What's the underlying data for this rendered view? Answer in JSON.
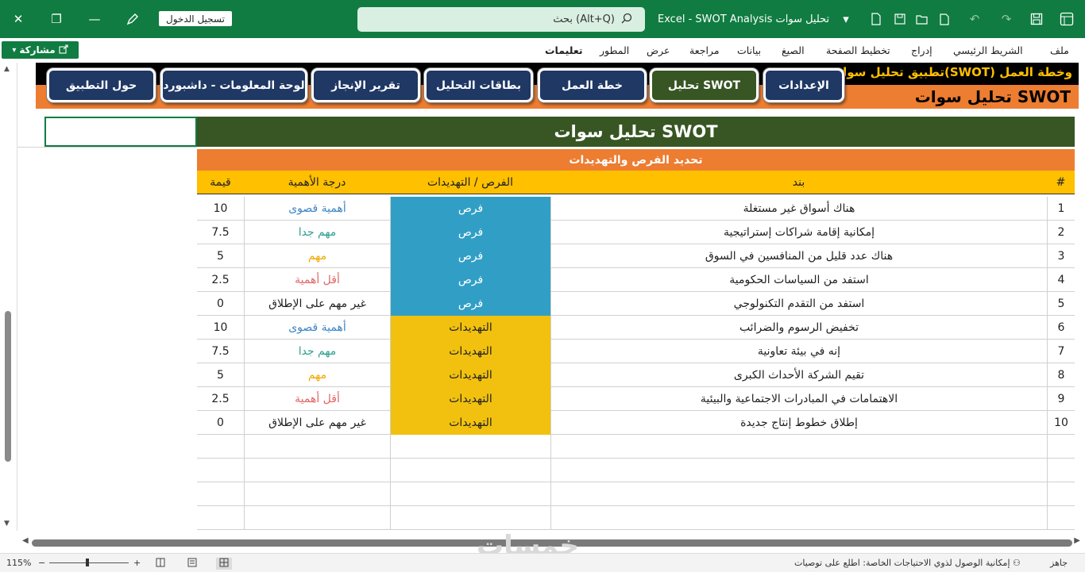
{
  "window": {
    "close": "✕",
    "restore": "❐",
    "minimize": "—",
    "signin": "تسجيل الدخول",
    "search": "بحث (Alt+Q)",
    "doc_title": "Excel  -  SWOT Analysis  تحليل سوات",
    "colors": {
      "excel_green": "#107c41"
    }
  },
  "share": "مشاركة",
  "ribbon": {
    "tabs": [
      "ملف",
      "الشريط الرئيسي",
      "إدراج",
      "تخطيط الصفحة",
      "الصيغ",
      "بيانات",
      "مراجعة",
      "عرض",
      "المطور",
      "تعليمات"
    ]
  },
  "app": {
    "name": "تطبيق تحليل سوات(SWOT) وخطة العمل",
    "page_title": "تحليل سوات SWOT",
    "nav": [
      "الإعدادات",
      "تحليل SWOT",
      "خطة العمل",
      "بطاقات التحليل",
      "تقرير الإنجاز",
      "لوحة المعلومات - داشبورد",
      "حول التطبيق"
    ],
    "active_nav": "تحليل SWOT",
    "colors": {
      "navy": "#1f3864",
      "dark_green": "#375623",
      "orange": "#ed7d31",
      "gold": "#ffc000",
      "opportunity_blue": "#319fc5"
    }
  },
  "table": {
    "title": "تحليل سوات SWOT",
    "subtitle": "تحديد الفرص والتهديدات",
    "headers": {
      "num": "#",
      "item": "بند",
      "type": "الفرص / التهديدات",
      "importance": "درجة الأهمية",
      "value": "قيمة"
    },
    "rows": [
      {
        "num": "1",
        "item": "هناك أسواق غير مستغلة",
        "type": "فرص",
        "importance": "أهمية قصوى",
        "value": "10"
      },
      {
        "num": "2",
        "item": "إمكانية إقامة شراكات إستراتيجية",
        "type": "فرص",
        "importance": "مهم جدا",
        "value": "7.5"
      },
      {
        "num": "3",
        "item": "هناك عدد قليل من المنافسين في السوق",
        "type": "فرص",
        "importance": "مهم",
        "value": "5"
      },
      {
        "num": "4",
        "item": "استفد من السياسات الحكومية",
        "type": "فرص",
        "importance": "أقل أهمية",
        "value": "2.5"
      },
      {
        "num": "5",
        "item": "استفد من التقدم التكنولوجي",
        "type": "فرص",
        "importance": "غير مهم على الإطلاق",
        "value": "0"
      },
      {
        "num": "6",
        "item": "تخفيض الرسوم والضرائب",
        "type": "التهديدات",
        "importance": "أهمية قصوى",
        "value": "10"
      },
      {
        "num": "7",
        "item": "إنه في بيئة تعاونية",
        "type": "التهديدات",
        "importance": "مهم جدا",
        "value": "7.5"
      },
      {
        "num": "8",
        "item": "تقيم الشركة الأحداث الكبرى",
        "type": "التهديدات",
        "importance": "مهم",
        "value": "5"
      },
      {
        "num": "9",
        "item": "الاهتمامات في المبادرات الاجتماعية والبيئية",
        "type": "التهديدات",
        "importance": "أقل أهمية",
        "value": "2.5"
      },
      {
        "num": "10",
        "item": "إطلاق خطوط إنتاج جديدة",
        "type": "التهديدات",
        "importance": "غير مهم على الإطلاق",
        "value": "0"
      }
    ],
    "importance_colors": {
      "أهمية قصوى": "#3d85c6",
      "مهم جدا": "#2f9e8f",
      "مهم": "#f0a800",
      "أقل أهمية": "#e06666",
      "غير مهم على الإطلاق": "#222222"
    },
    "type_colors": {
      "فرص": "#319fc5",
      "التهديدات": "#f2c10f"
    }
  },
  "status": {
    "ready": "جاهز",
    "accessibility": "إمكانية الوصول لذوي الاحتياجات الخاصة: اطلع على توصيات",
    "zoom": "115%",
    "watermark": "خمسات"
  }
}
